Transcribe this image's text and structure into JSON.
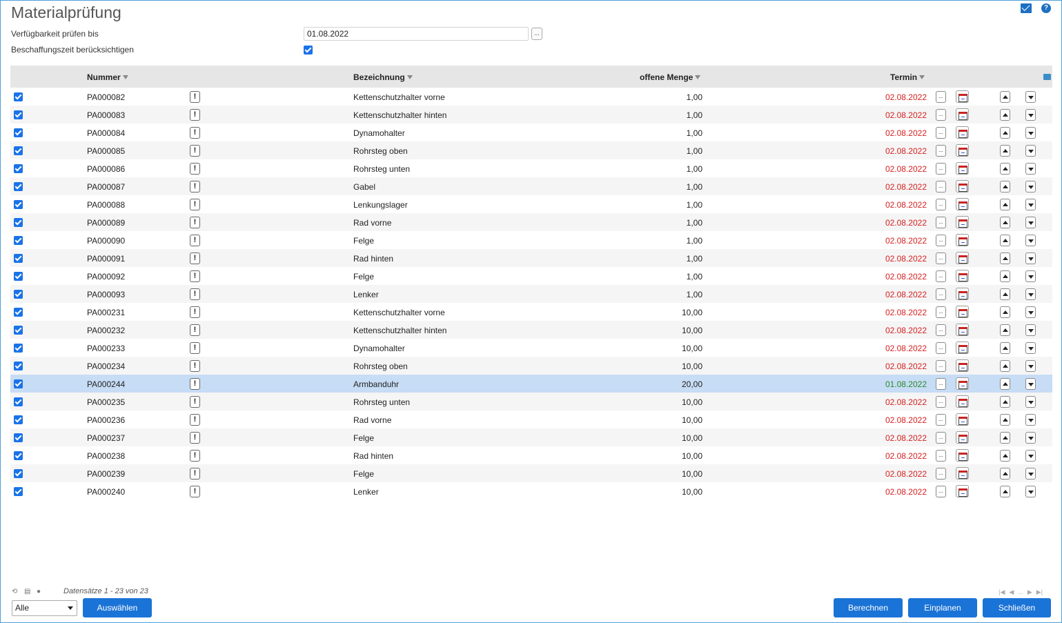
{
  "title": "Materialprüfung",
  "form": {
    "availability_label": "Verfügbarkeit prüfen bis",
    "availability_value": "01.08.2022",
    "procurement_label": "Beschaffungszeit berücksichtigen",
    "procurement_checked": true
  },
  "table": {
    "columns": {
      "nummer": "Nummer",
      "bezeichnung": "Bezeichnung",
      "menge": "offene Menge",
      "termin": "Termin"
    },
    "rows": [
      {
        "nummer": "PA000082",
        "bezeichnung": "Kettenschutzhalter vorne",
        "menge": "1,00",
        "termin": "02.08.2022",
        "status": "red"
      },
      {
        "nummer": "PA000083",
        "bezeichnung": "Kettenschutzhalter hinten",
        "menge": "1,00",
        "termin": "02.08.2022",
        "status": "red"
      },
      {
        "nummer": "PA000084",
        "bezeichnung": "Dynamohalter",
        "menge": "1,00",
        "termin": "02.08.2022",
        "status": "red"
      },
      {
        "nummer": "PA000085",
        "bezeichnung": "Rohrsteg oben",
        "menge": "1,00",
        "termin": "02.08.2022",
        "status": "red"
      },
      {
        "nummer": "PA000086",
        "bezeichnung": "Rohrsteg unten",
        "menge": "1,00",
        "termin": "02.08.2022",
        "status": "red"
      },
      {
        "nummer": "PA000087",
        "bezeichnung": "Gabel",
        "menge": "1,00",
        "termin": "02.08.2022",
        "status": "red"
      },
      {
        "nummer": "PA000088",
        "bezeichnung": "Lenkungslager",
        "menge": "1,00",
        "termin": "02.08.2022",
        "status": "red"
      },
      {
        "nummer": "PA000089",
        "bezeichnung": "Rad vorne",
        "menge": "1,00",
        "termin": "02.08.2022",
        "status": "red"
      },
      {
        "nummer": "PA000090",
        "bezeichnung": "Felge",
        "menge": "1,00",
        "termin": "02.08.2022",
        "status": "red"
      },
      {
        "nummer": "PA000091",
        "bezeichnung": "Rad hinten",
        "menge": "1,00",
        "termin": "02.08.2022",
        "status": "red"
      },
      {
        "nummer": "PA000092",
        "bezeichnung": "Felge",
        "menge": "1,00",
        "termin": "02.08.2022",
        "status": "red"
      },
      {
        "nummer": "PA000093",
        "bezeichnung": "Lenker",
        "menge": "1,00",
        "termin": "02.08.2022",
        "status": "red"
      },
      {
        "nummer": "PA000231",
        "bezeichnung": "Kettenschutzhalter vorne",
        "menge": "10,00",
        "termin": "02.08.2022",
        "status": "red"
      },
      {
        "nummer": "PA000232",
        "bezeichnung": "Kettenschutzhalter hinten",
        "menge": "10,00",
        "termin": "02.08.2022",
        "status": "red"
      },
      {
        "nummer": "PA000233",
        "bezeichnung": "Dynamohalter",
        "menge": "10,00",
        "termin": "02.08.2022",
        "status": "red"
      },
      {
        "nummer": "PA000234",
        "bezeichnung": "Rohrsteg oben",
        "menge": "10,00",
        "termin": "02.08.2022",
        "status": "red"
      },
      {
        "nummer": "PA000244",
        "bezeichnung": "Armbanduhr",
        "menge": "20,00",
        "termin": "01.08.2022",
        "status": "green",
        "selected": true
      },
      {
        "nummer": "PA000235",
        "bezeichnung": "Rohrsteg unten",
        "menge": "10,00",
        "termin": "02.08.2022",
        "status": "red"
      },
      {
        "nummer": "PA000236",
        "bezeichnung": "Rad vorne",
        "menge": "10,00",
        "termin": "02.08.2022",
        "status": "red"
      },
      {
        "nummer": "PA000237",
        "bezeichnung": "Felge",
        "menge": "10,00",
        "termin": "02.08.2022",
        "status": "red"
      },
      {
        "nummer": "PA000238",
        "bezeichnung": "Rad hinten",
        "menge": "10,00",
        "termin": "02.08.2022",
        "status": "red"
      },
      {
        "nummer": "PA000239",
        "bezeichnung": "Felge",
        "menge": "10,00",
        "termin": "02.08.2022",
        "status": "red"
      },
      {
        "nummer": "PA000240",
        "bezeichnung": "Lenker",
        "menge": "10,00",
        "termin": "02.08.2022",
        "status": "red"
      }
    ]
  },
  "footer": {
    "records": "Datensätze 1 - 23 von 23",
    "filter_value": "Alle",
    "select_button": "Auswählen",
    "calc_button": "Berechnen",
    "plan_button": "Einplanen",
    "close_button": "Schließen",
    "pager_ellipsis": "..."
  },
  "colors": {
    "accent": "#1a73d6",
    "late": "#d52020",
    "ok": "#2a8a2a",
    "selected_row": "#c7dcf5"
  }
}
